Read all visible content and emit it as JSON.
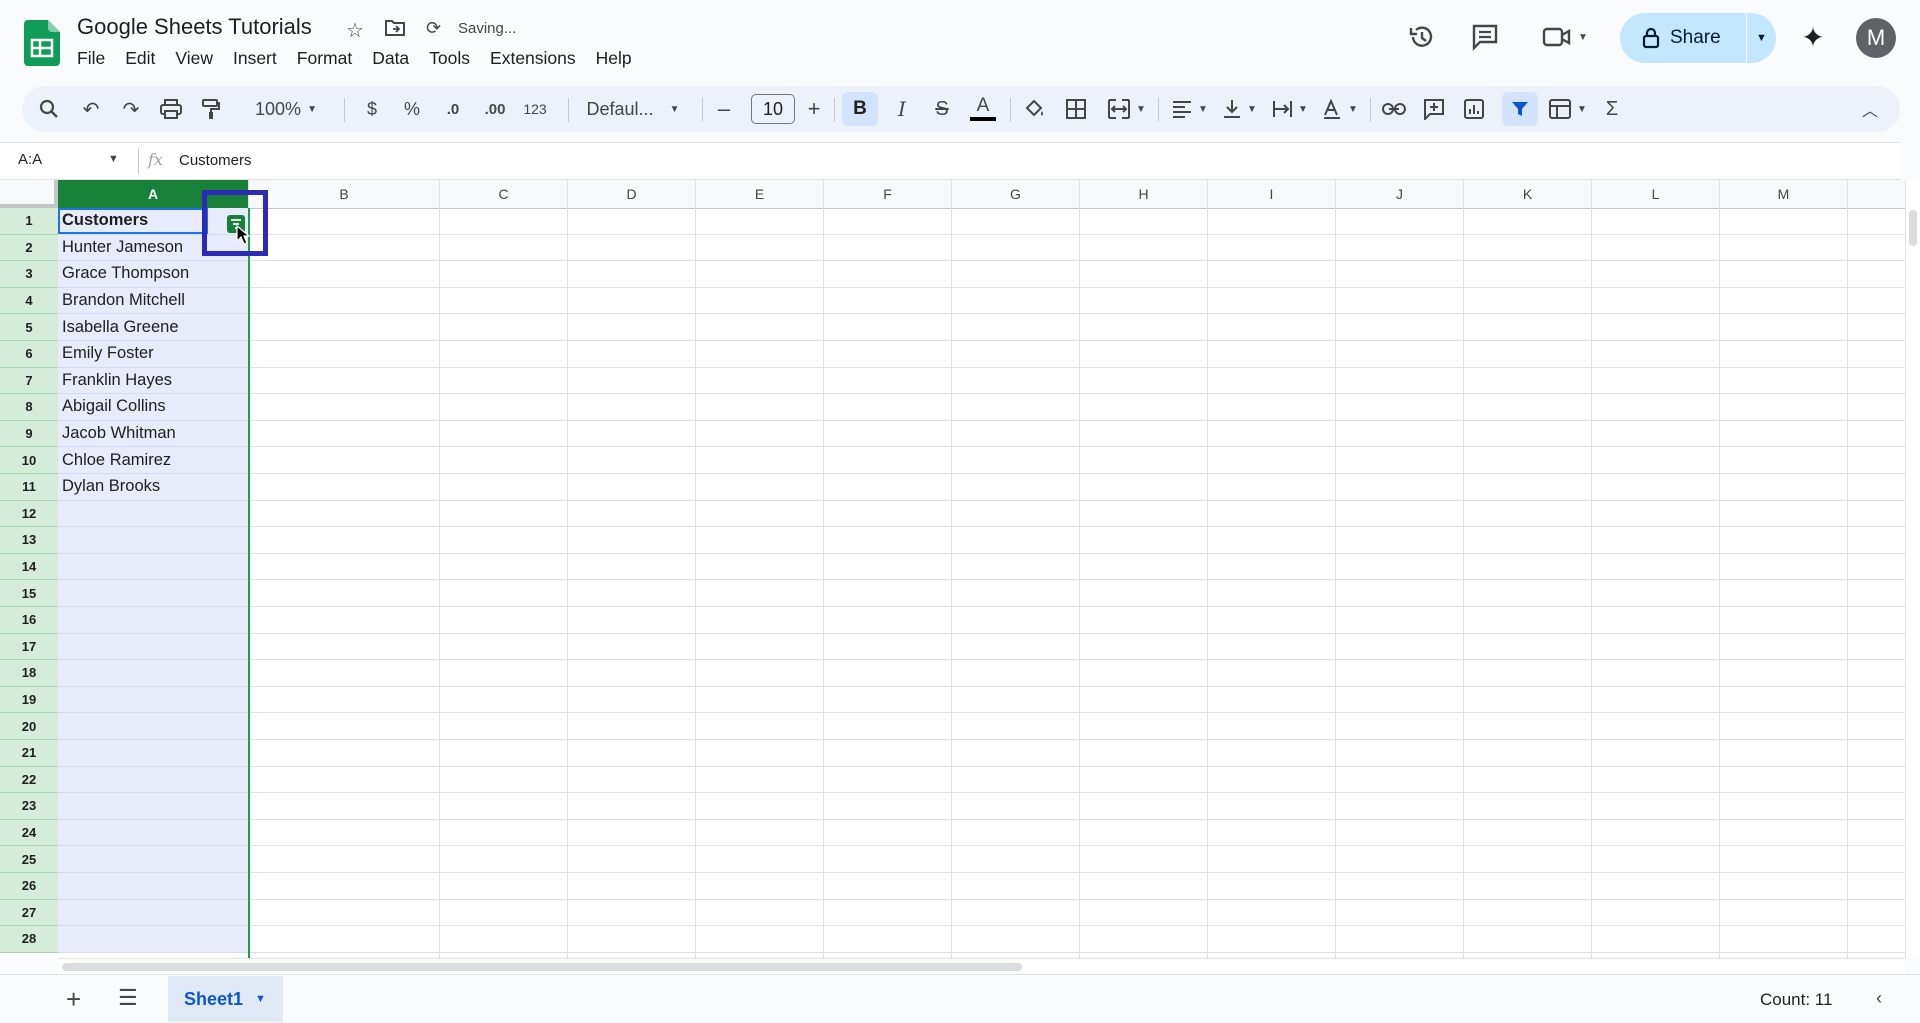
{
  "doc": {
    "title": "Google Sheets Tutorials",
    "status": "Saving..."
  },
  "menu": [
    "File",
    "Edit",
    "View",
    "Insert",
    "Format",
    "Data",
    "Tools",
    "Extensions",
    "Help"
  ],
  "share": {
    "label": "Share"
  },
  "avatar": {
    "initial": "M"
  },
  "toolbar": {
    "zoom": "100%",
    "currency": "$",
    "percent": "%",
    "decrease_decimal": ".0",
    "increase_decimal": ".00",
    "number_format": "123",
    "font": "Defaul...",
    "font_size": "10",
    "bold": "B",
    "italic": "I",
    "strikethrough": "S",
    "text_color": "A",
    "sum": "Σ"
  },
  "formula_bar": {
    "name_box": "A:A",
    "fx": "fx",
    "content": "Customers"
  },
  "grid": {
    "columns": [
      "A",
      "B",
      "C",
      "D",
      "E",
      "F",
      "G",
      "H",
      "I",
      "J",
      "K",
      "L",
      "M"
    ],
    "rows": [
      "1",
      "2",
      "3",
      "4",
      "5",
      "6",
      "7",
      "8",
      "9",
      "10",
      "11",
      "12",
      "13",
      "14",
      "15",
      "16",
      "17",
      "18",
      "19",
      "20",
      "21",
      "22",
      "23",
      "24",
      "25",
      "26",
      "27",
      "28"
    ],
    "column_a": [
      "Customers",
      "Hunter Jameson",
      "Grace Thompson",
      "Brandon Mitchell",
      "Isabella Greene",
      "Emily Foster",
      "Franklin Hayes",
      "Abigail Collins",
      "Jacob Whitman",
      "Chloe Ramirez",
      "Dylan Brooks"
    ]
  },
  "sheets": {
    "active": "Sheet1"
  },
  "status_bar": {
    "summary": "Count: 11"
  },
  "colors": {
    "selected_column": "#188038",
    "selection_fill": "#e7ebfa",
    "highlight_box": "#2d2bb5",
    "share_button": "#c2e7ff"
  }
}
